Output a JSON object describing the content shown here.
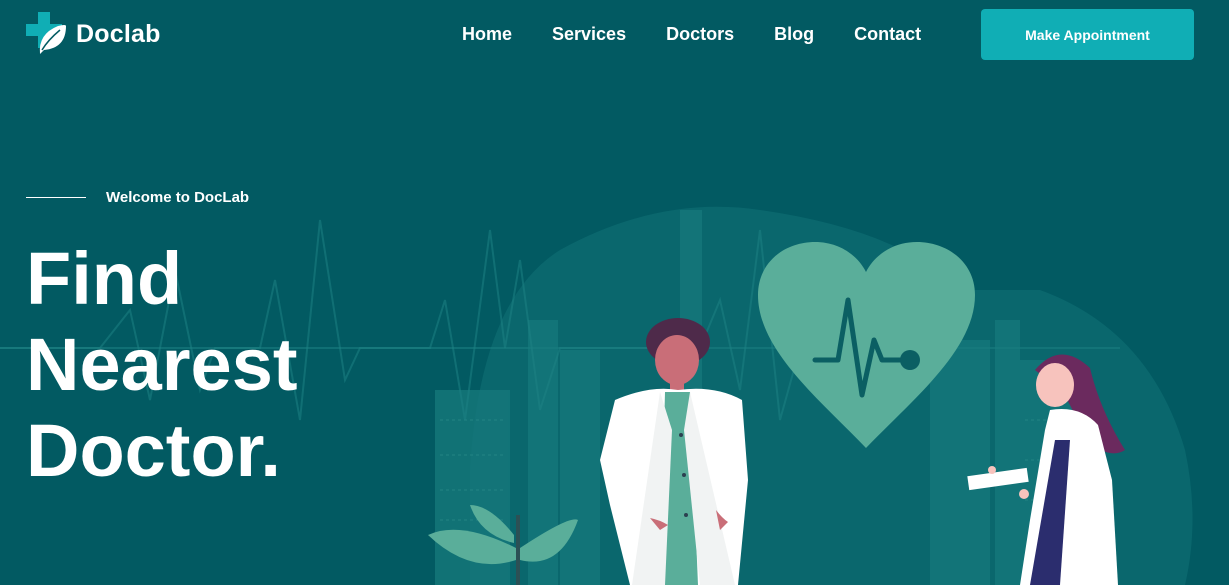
{
  "header": {
    "logo_text": "Doclab",
    "logo_icon": "medical-cross-leaf-icon",
    "nav": [
      "Home",
      "Services",
      "Doctors",
      "Blog",
      "Contact"
    ],
    "cta_label": "Make Appointment"
  },
  "hero": {
    "eyebrow": "Welcome to DocLab",
    "headline": [
      "Find",
      "Nearest",
      "Doctor."
    ]
  },
  "colors": {
    "background": "#025a62",
    "accent": "#10aeb5",
    "heart": "#5aae9a",
    "text": "#ffffff"
  }
}
